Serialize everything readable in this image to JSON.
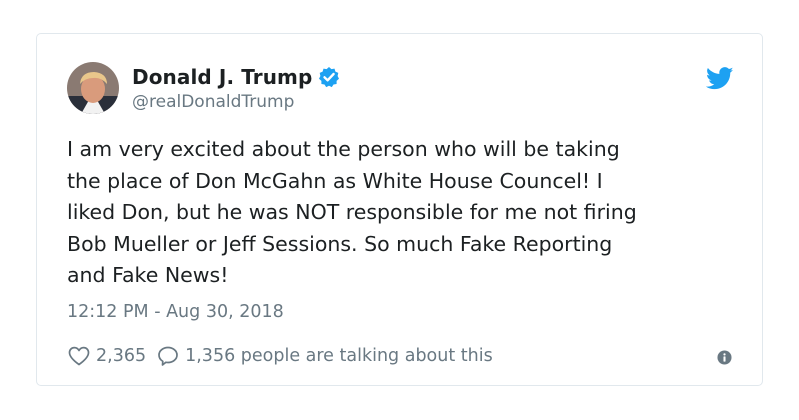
{
  "tweet": {
    "author": {
      "name": "Donald J. Trump",
      "handle": "@realDonaldTrump",
      "verified": true
    },
    "text_lines": [
      "I am very excited about the person who will be taking",
      "the place of Don McGahn as White House Councel! I",
      "liked Don, but he was NOT responsible for me not firing",
      "Bob Mueller or Jeff Sessions. So much Fake Reporting",
      "and Fake News!"
    ],
    "timestamp": "12:12 PM - Aug 30, 2018",
    "likes": "2,365",
    "conversation": "1,356 people are talking about this"
  },
  "colors": {
    "brand_blue": "#1da1f2",
    "muted_text": "#697882",
    "border": "#e1e8ed"
  },
  "icons": [
    "profile-avatar",
    "verified-badge-icon",
    "twitter-bird-icon",
    "heart-icon",
    "speech-bubble-icon",
    "info-icon"
  ]
}
